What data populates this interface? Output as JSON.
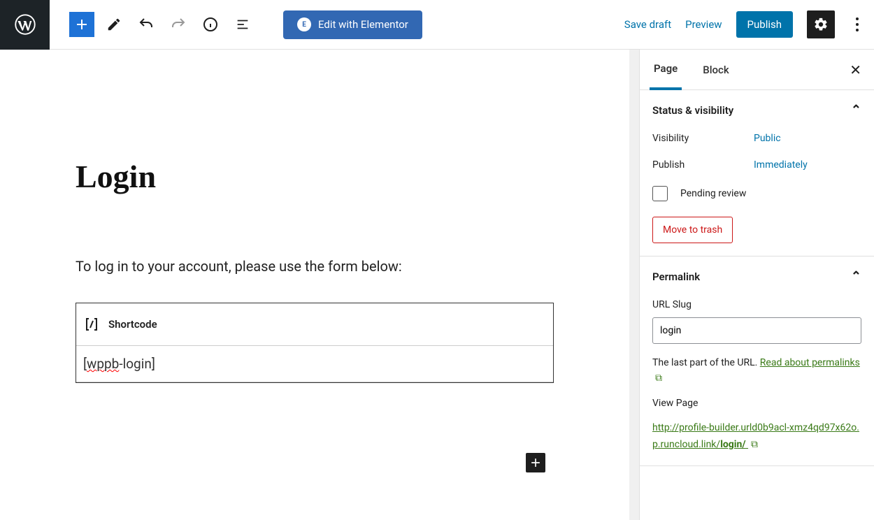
{
  "toolbar": {
    "elementor_label": "Edit with Elementor",
    "save_draft": "Save draft",
    "preview": "Preview",
    "publish": "Publish"
  },
  "editor": {
    "title": "Login",
    "intro": "To log in to your account, please use the form below:",
    "block_label": "Shortcode",
    "shortcode_prefix": "[",
    "shortcode_misspell": "wppb",
    "shortcode_suffix": "-login]"
  },
  "sidebar": {
    "tabs": {
      "page": "Page",
      "block": "Block"
    },
    "status": {
      "heading": "Status & visibility",
      "visibility_label": "Visibility",
      "visibility_value": "Public",
      "publish_label": "Publish",
      "publish_value": "Immediately",
      "pending_review": "Pending review",
      "trash": "Move to trash"
    },
    "permalink": {
      "heading": "Permalink",
      "slug_label": "URL Slug",
      "slug_value": "login",
      "help_prefix": "The last part of the URL. ",
      "help_link": "Read about permalinks",
      "view_page": "View Page",
      "url_prefix": "http://profile-builder.urld0b9acl-xmz4qd97x62o.p.runcloud.link/",
      "url_bold": "login/"
    }
  }
}
